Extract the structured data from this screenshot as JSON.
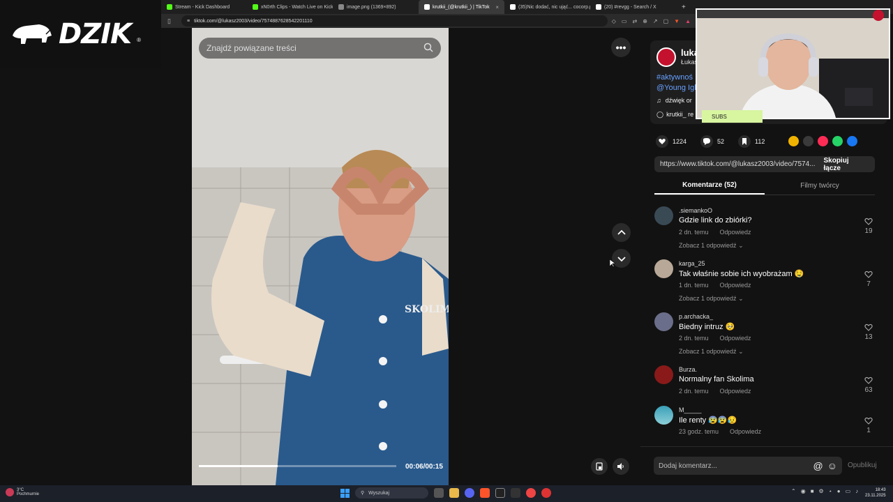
{
  "browser": {
    "tabs": [
      {
        "title": "Stream - Kick Dashboard",
        "color": "#53fc18"
      },
      {
        "title": "xN0rth Clips - Watch Live on Kick",
        "color": "#53fc18"
      },
      {
        "title": "image.png (1369×892)",
        "color": "#888888"
      },
      {
        "title": "krutkii_(@krutkii_) | TikTok",
        "color": "#ffffff"
      },
      {
        "title": "(35)Nic dodać, nic ująć... cocorp.pl",
        "color": "#ffffff"
      },
      {
        "title": "(20) #revgg - Search / X",
        "color": "#ffffff"
      }
    ],
    "active_tab": 3,
    "new_tab": "+",
    "url": "tiktok.com/@lukasz2003/video/7574887628542201110"
  },
  "overlay": {
    "brand": "DZIK",
    "brand_mark": "®",
    "subs_label": "SUBS"
  },
  "video": {
    "search_placeholder": "Znajdź powiązane treści",
    "time": "00:06/00:15",
    "progress": 0.4
  },
  "author": {
    "name": "luka",
    "subname": "Łukas",
    "hashtag_line1": "#aktywnoś",
    "hashtag_line2": "@Young Igl",
    "music": "dźwięk or",
    "krutkii": "krutkii_ re"
  },
  "stats": {
    "likes": "1224",
    "comments": "52",
    "saves": "112"
  },
  "share": {
    "colors": [
      "#f0b400",
      "#3a3a3a",
      "#fe2c55",
      "#25d366",
      "#1877f2",
      "#121212"
    ]
  },
  "link": {
    "url": "https://www.tiktok.com/@lukasz2003/video/7574...",
    "copy_label": "Skopiuj łącze"
  },
  "tabs": {
    "comments_label": "Komentarze (52)",
    "creator_label": "Filmy twórcy"
  },
  "comments": [
    {
      "user": ".siemankoO",
      "text": "Gdzie link do zbiórki?",
      "time": "2 dn. temu",
      "reply": "Odpowiedz",
      "more": "Zobacz 1 odpowiedź",
      "likes": "19",
      "avatar": "#3a4a55"
    },
    {
      "user": "karga_25",
      "text": "Tak właśnie sobie ich wyobrażam 🤤",
      "time": "1 dn. temu",
      "reply": "Odpowiedz",
      "more": "Zobacz 1 odpowiedź",
      "likes": "7",
      "avatar": "#b8a898"
    },
    {
      "user": "p.archacka_",
      "text": "Biedny intruz 🥺",
      "time": "2 dn. temu",
      "reply": "Odpowiedz",
      "more": "Zobacz 1 odpowiedź",
      "likes": "13",
      "avatar": "#6a6e8a"
    },
    {
      "user": "Burza.",
      "text": "Normalny fan Skolima",
      "time": "2 dn. temu",
      "reply": "Odpowiedz",
      "more": "",
      "likes": "63",
      "avatar": "#8a1a1a"
    },
    {
      "user": "M_____",
      "text": "Ile renty 😰😰😥",
      "time": "23 godz. temu",
      "reply": "Odpowiedz",
      "more": "",
      "likes": "1",
      "avatar": "#3aa0b8"
    }
  ],
  "add_comment": {
    "placeholder": "Dodaj komentarz...",
    "publish": "Opublikuj"
  },
  "taskbar": {
    "weather_temp": "3°C",
    "weather_desc": "Pochmurnie",
    "search": "Wyszukaj",
    "time": "18:43",
    "date": "23.11.2025"
  }
}
